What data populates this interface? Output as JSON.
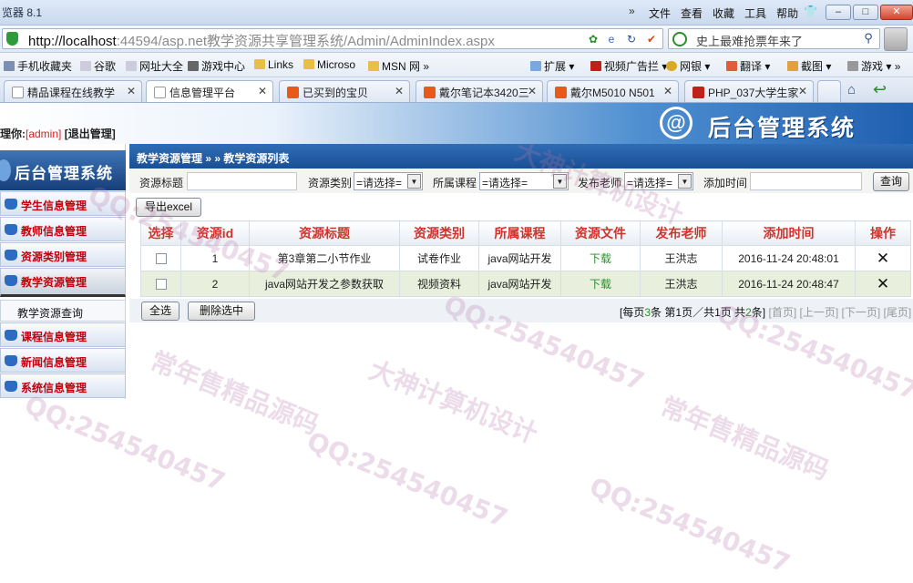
{
  "browser": {
    "title": "览器 8.1",
    "menu": [
      "文件",
      "查看",
      "收藏",
      "工具",
      "帮助"
    ],
    "url_host": "http://localhost",
    "url_rest": ":44594/asp.net教学资源共享管理系统/Admin/AdminIndex.aspx",
    "search_placeholder": "史上最难抢票年来了",
    "favorites": [
      "手机收藏夹",
      "谷歌",
      "网址大全",
      "游戏中心",
      "Links",
      "Microso",
      "MSN 网",
      "扩展",
      "视频广告拦",
      "网银",
      "翻译",
      "截图",
      "游戏"
    ],
    "tabs": [
      "精品课程在线教学",
      "信息管理平台",
      "已买到的宝贝",
      "戴尔笔记本3420三",
      "戴尔M5010 N501",
      "PHP_037大学生家"
    ],
    "colors": {
      "tab_icon_taobao": "#e85a1a",
      "tab_icon_php": "#c0201a"
    }
  },
  "header": {
    "welcome_prefix": "理你:",
    "user": "[admin]",
    "logout": "[退出管理]",
    "logo_char": "@",
    "system_name": "后台管理系统"
  },
  "sidebar": {
    "title": "后台管理系统",
    "items": [
      "学生信息管理",
      "教师信息管理",
      "资源类别管理",
      "教学资源管理",
      "课程信息管理",
      "新闻信息管理",
      "系统信息管理"
    ],
    "sub_item": "教学资源查询"
  },
  "main": {
    "breadcrumb": "教学资源管理 » » 教学资源列表",
    "filters": {
      "title_label": "资源标题",
      "type_label": "资源类别",
      "type_value": "=请选择=",
      "course_label": "所属课程",
      "course_value": "=请选择=",
      "teacher_label": "发布老师",
      "teacher_value": "=请选择=",
      "time_label": "添加时间",
      "query_button": "查询"
    },
    "export_button": "导出excel",
    "table": {
      "columns": [
        "选择",
        "资源id",
        "资源标题",
        "资源类别",
        "所属课程",
        "资源文件",
        "发布老师",
        "添加时间",
        "操作"
      ],
      "rows": [
        {
          "id": "1",
          "title": "第3章第二小节作业",
          "type": "试卷作业",
          "course": "java网站开发",
          "file": "下载",
          "teacher": "王洪志",
          "time": "2016-11-24 20:48:01"
        },
        {
          "id": "2",
          "title": "java网站开发之参数获取",
          "type": "视频资料",
          "course": "java网站开发",
          "file": "下载",
          "teacher": "王洪志",
          "time": "2016-11-24 20:48:47"
        }
      ]
    },
    "select_all": "全选",
    "delete_selected": "删除选中",
    "pager": {
      "prefix": "[每页",
      "per_page": "3",
      "mid1": "条 第",
      "current": "1",
      "mid2": "页／共",
      "total_pages": "1",
      "mid3": "页 共",
      "total": "2",
      "suffix": "条]",
      "first": "[首页]",
      "prev": "[上一页]",
      "next": "[下一页]",
      "last": "[尾页]"
    }
  },
  "watermarks": [
    "常年售精品源码",
    "QQ:254540457",
    "大神计算机设计"
  ]
}
